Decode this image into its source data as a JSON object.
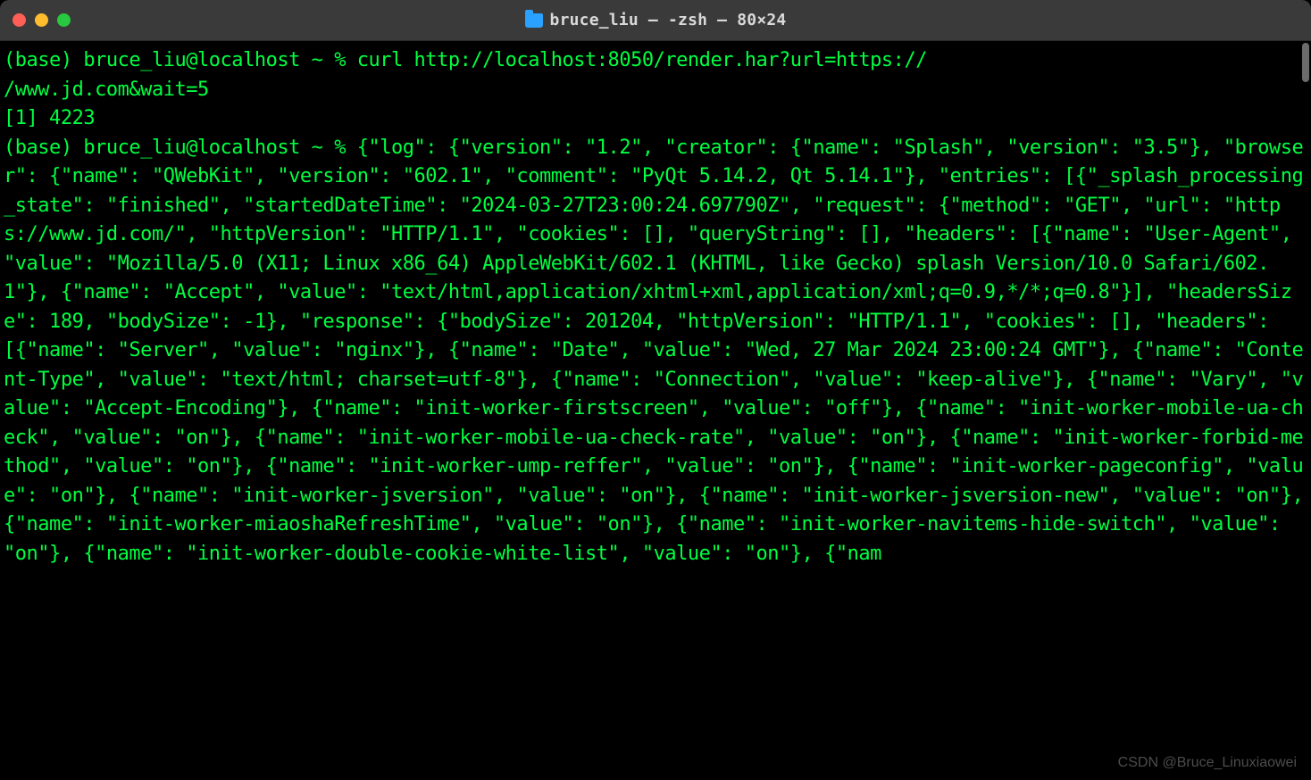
{
  "window": {
    "title": "bruce_liu — -zsh — 80×24"
  },
  "terminal": {
    "text_color": "#00ff41",
    "background": "#000000",
    "content": "(base) bruce_liu@localhost ~ % curl http://localhost:8050/render.har?url=https://\n/www.jd.com&wait=5\n[1] 4223\n(base) bruce_liu@localhost ~ % {\"log\": {\"version\": \"1.2\", \"creator\": {\"name\": \"Splash\", \"version\": \"3.5\"}, \"browser\": {\"name\": \"QWebKit\", \"version\": \"602.1\", \"comment\": \"PyQt 5.14.2, Qt 5.14.1\"}, \"entries\": [{\"_splash_processing_state\": \"finished\", \"startedDateTime\": \"2024-03-27T23:00:24.697790Z\", \"request\": {\"method\": \"GET\", \"url\": \"https://www.jd.com/\", \"httpVersion\": \"HTTP/1.1\", \"cookies\": [], \"queryString\": [], \"headers\": [{\"name\": \"User-Agent\", \"value\": \"Mozilla/5.0 (X11; Linux x86_64) AppleWebKit/602.1 (KHTML, like Gecko) splash Version/10.0 Safari/602.1\"}, {\"name\": \"Accept\", \"value\": \"text/html,application/xhtml+xml,application/xml;q=0.9,*/*;q=0.8\"}], \"headersSize\": 189, \"bodySize\": -1}, \"response\": {\"bodySize\": 201204, \"httpVersion\": \"HTTP/1.1\", \"cookies\": [], \"headers\": [{\"name\": \"Server\", \"value\": \"nginx\"}, {\"name\": \"Date\", \"value\": \"Wed, 27 Mar 2024 23:00:24 GMT\"}, {\"name\": \"Content-Type\", \"value\": \"text/html; charset=utf-8\"}, {\"name\": \"Connection\", \"value\": \"keep-alive\"}, {\"name\": \"Vary\", \"value\": \"Accept-Encoding\"}, {\"name\": \"init-worker-firstscreen\", \"value\": \"off\"}, {\"name\": \"init-worker-mobile-ua-check\", \"value\": \"on\"}, {\"name\": \"init-worker-mobile-ua-check-rate\", \"value\": \"on\"}, {\"name\": \"init-worker-forbid-method\", \"value\": \"on\"}, {\"name\": \"init-worker-ump-reffer\", \"value\": \"on\"}, {\"name\": \"init-worker-pageconfig\", \"value\": \"on\"}, {\"name\": \"init-worker-jsversion\", \"value\": \"on\"}, {\"name\": \"init-worker-jsversion-new\", \"value\": \"on\"}, {\"name\": \"init-worker-miaoshaRefreshTime\", \"value\": \"on\"}, {\"name\": \"init-worker-navitems-hide-switch\", \"value\": \"on\"}, {\"name\": \"init-worker-double-cookie-white-list\", \"value\": \"on\"}, {\"nam"
  },
  "watermark": "CSDN @Bruce_Linuxiaowei"
}
